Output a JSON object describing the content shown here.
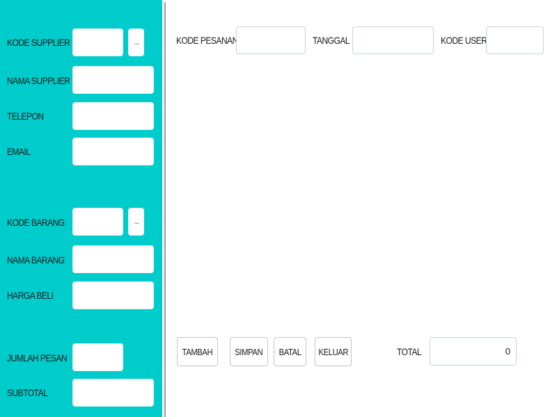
{
  "supplier": {
    "kode_label": "KODE SUPPLIER",
    "kode_value": "",
    "lookup_label": "...",
    "nama_label": "NAMA SUPPLIER",
    "nama_value": "",
    "telepon_label": "TELEPON",
    "telepon_value": "",
    "email_label": "EMAIL",
    "email_value": ""
  },
  "barang": {
    "kode_label": "KODE BARANG",
    "kode_value": "",
    "lookup_label": "...",
    "nama_label": "NAMA BARANG",
    "nama_value": "",
    "harga_label": "HARGA BELI",
    "harga_value": ""
  },
  "order": {
    "jumlah_label": "JUMLAH PESAN",
    "jumlah_value": "",
    "subtotal_label": "SUBTOTAL",
    "subtotal_value": ""
  },
  "header": {
    "kode_pesanan_label": "KODE PESANAN",
    "kode_pesanan_value": "",
    "tanggal_label": "TANGGAL",
    "tanggal_value": "",
    "kode_user_label": "KODE USER",
    "kode_user_value": ""
  },
  "actions": {
    "tambah": "TAMBAH",
    "simpan": "SIMPAN",
    "batal": "BATAL",
    "keluar": "KELUAR"
  },
  "total": {
    "label": "TOTAL",
    "value": "0"
  },
  "colors": {
    "left_panel": "#00cccc",
    "divider": "#9a9a9a"
  }
}
